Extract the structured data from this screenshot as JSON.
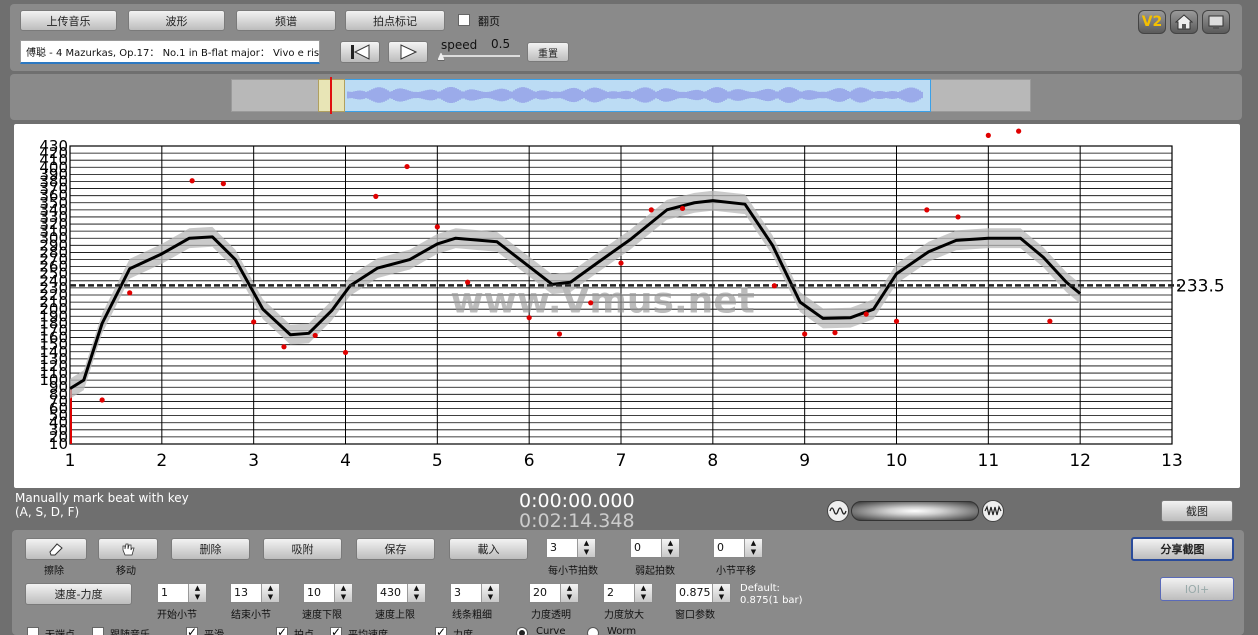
{
  "toolbar": {
    "upload_label": "上传音乐",
    "waveform_label": "波形",
    "spectrum_label": "频谱",
    "tap_mark_label": "拍点标记",
    "flip_label": "翻页",
    "flip_checked": false
  },
  "track": {
    "title": "傅聪 - 4 Mazurkas, Op.17： No.1 in B-flat major： Vivo e ris"
  },
  "playback": {
    "speed_label": "speed",
    "speed_value": "0.5",
    "reset_label": "重置"
  },
  "corner_icons": {
    "v2_label": "V2",
    "home": "home-icon",
    "screen": "screen-icon"
  },
  "chart_data": {
    "type": "line",
    "title": "",
    "xlabel": "",
    "ylabel": "",
    "xlim": [
      1,
      13
    ],
    "ylim": [
      10,
      430
    ],
    "x_ticks": [
      "1",
      "2",
      "3",
      "4",
      "5",
      "6",
      "7",
      "8",
      "9",
      "10",
      "11",
      "12",
      "13"
    ],
    "y_ticks": [
      "10",
      "20",
      "30",
      "40",
      "50",
      "60",
      "70",
      "80",
      "90",
      "100",
      "110",
      "120",
      "130",
      "140",
      "150",
      "160",
      "170",
      "180",
      "190",
      "200",
      "210",
      "220",
      "230",
      "240",
      "250",
      "260",
      "270",
      "280",
      "290",
      "300",
      "310",
      "320",
      "330",
      "340",
      "350",
      "360",
      "370",
      "380",
      "390",
      "400",
      "410",
      "420",
      "430"
    ],
    "reference_line": 233.5,
    "reference_label": "233.5",
    "watermark": "www.Vmus.net",
    "curve": [
      {
        "x": 1.0,
        "y": 88
      },
      {
        "x": 1.15,
        "y": 100
      },
      {
        "x": 1.35,
        "y": 180
      },
      {
        "x": 1.65,
        "y": 257
      },
      {
        "x": 2.0,
        "y": 278
      },
      {
        "x": 2.3,
        "y": 300
      },
      {
        "x": 2.55,
        "y": 302
      },
      {
        "x": 2.8,
        "y": 270
      },
      {
        "x": 3.1,
        "y": 200
      },
      {
        "x": 3.4,
        "y": 164
      },
      {
        "x": 3.6,
        "y": 166
      },
      {
        "x": 3.85,
        "y": 198
      },
      {
        "x": 4.05,
        "y": 233
      },
      {
        "x": 4.35,
        "y": 258
      },
      {
        "x": 4.7,
        "y": 270
      },
      {
        "x": 5.0,
        "y": 292
      },
      {
        "x": 5.2,
        "y": 300
      },
      {
        "x": 5.65,
        "y": 295
      },
      {
        "x": 6.0,
        "y": 260
      },
      {
        "x": 6.25,
        "y": 235
      },
      {
        "x": 6.45,
        "y": 238
      },
      {
        "x": 6.75,
        "y": 266
      },
      {
        "x": 7.1,
        "y": 298
      },
      {
        "x": 7.5,
        "y": 340
      },
      {
        "x": 7.8,
        "y": 350
      },
      {
        "x": 8.0,
        "y": 353
      },
      {
        "x": 8.35,
        "y": 348
      },
      {
        "x": 8.65,
        "y": 290
      },
      {
        "x": 8.95,
        "y": 210
      },
      {
        "x": 9.2,
        "y": 187
      },
      {
        "x": 9.5,
        "y": 188
      },
      {
        "x": 9.75,
        "y": 200
      },
      {
        "x": 10.0,
        "y": 250
      },
      {
        "x": 10.35,
        "y": 281
      },
      {
        "x": 10.65,
        "y": 297
      },
      {
        "x": 11.0,
        "y": 300
      },
      {
        "x": 11.35,
        "y": 300
      },
      {
        "x": 11.6,
        "y": 273
      },
      {
        "x": 11.85,
        "y": 238
      },
      {
        "x": 12.0,
        "y": 222
      }
    ],
    "points": [
      {
        "x": 1.35,
        "y": 72
      },
      {
        "x": 1.65,
        "y": 223
      },
      {
        "x": 2.33,
        "y": 381
      },
      {
        "x": 2.67,
        "y": 377
      },
      {
        "x": 3.0,
        "y": 182
      },
      {
        "x": 3.33,
        "y": 147
      },
      {
        "x": 3.67,
        "y": 163
      },
      {
        "x": 4.0,
        "y": 139
      },
      {
        "x": 4.33,
        "y": 359
      },
      {
        "x": 4.67,
        "y": 401
      },
      {
        "x": 5.0,
        "y": 316
      },
      {
        "x": 5.33,
        "y": 238
      },
      {
        "x": 6.0,
        "y": 188
      },
      {
        "x": 6.33,
        "y": 165
      },
      {
        "x": 6.67,
        "y": 209
      },
      {
        "x": 7.0,
        "y": 265
      },
      {
        "x": 7.33,
        "y": 340
      },
      {
        "x": 7.67,
        "y": 342
      },
      {
        "x": 8.67,
        "y": 233
      },
      {
        "x": 9.0,
        "y": 165
      },
      {
        "x": 9.33,
        "y": 167
      },
      {
        "x": 9.67,
        "y": 193
      },
      {
        "x": 10.0,
        "y": 183
      },
      {
        "x": 10.33,
        "y": 340
      },
      {
        "x": 10.67,
        "y": 330
      },
      {
        "x": 11.0,
        "y": 445
      },
      {
        "x": 11.33,
        "y": 451
      },
      {
        "x": 11.67,
        "y": 183
      }
    ],
    "grid": true
  },
  "status": {
    "hint_line1": "Manually mark beat with key",
    "hint_line2": "(A, S, D, F)",
    "current_time": "0:00:00.000",
    "total_time": "0:02:14.348",
    "screenshot_label": "截图",
    "share_label": "分享截图"
  },
  "controls": {
    "erase_label": "擦除",
    "move_label": "移动",
    "delete_label": "删除",
    "snap_label": "吸附",
    "save_label": "保存",
    "load_label": "載入",
    "beats_per_bar": {
      "value": "3",
      "label": "每小节拍数"
    },
    "pickup_beats": {
      "value": "0",
      "label": "弱起拍数"
    },
    "bar_shift": {
      "value": "0",
      "label": "小节平移"
    },
    "tempo_dynamics_label": "速度-力度",
    "start_bar": {
      "value": "1",
      "label": "开始小节"
    },
    "end_bar": {
      "value": "13",
      "label": "结束小节"
    },
    "tempo_min": {
      "value": "10",
      "label": "速度下限"
    },
    "tempo_max": {
      "value": "430",
      "label": "速度上限"
    },
    "line_width": {
      "value": "3",
      "label": "线条粗细"
    },
    "dyn_transparency": {
      "value": "20",
      "label": "力度透明"
    },
    "dyn_zoom": {
      "value": "2",
      "label": "力度放大"
    },
    "window_param": {
      "value": "0.875",
      "label": "窗口参数"
    },
    "default_line1": "Default:",
    "default_line2": "0.875(1 bar)",
    "row3": [
      {
        "label": "无端点",
        "checked": false
      },
      {
        "label": "跟随音乐",
        "checked": false
      },
      {
        "label": "平滑",
        "checked": true
      },
      {
        "label": "拍点",
        "checked": true
      },
      {
        "label": "平均速度",
        "checked": true
      },
      {
        "label": "力度",
        "checked": true
      }
    ],
    "curve_label": "Curve",
    "worm_label": "Worm",
    "disabled_btn_label": "IOI+"
  }
}
